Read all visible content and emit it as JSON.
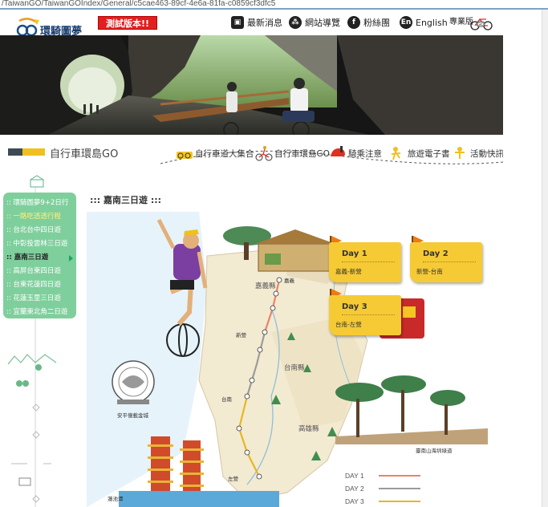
{
  "browser": {
    "url": "/TaiwanGO/TaiwanGOIndex/General/c5cae463-89cf-4e6a-81fa-c0859cf3dfc5"
  },
  "header": {
    "logo_text": "環騎圖夢",
    "test_badge": "測試版本!!",
    "nav": [
      {
        "label": "最新消息",
        "icon": "news-icon"
      },
      {
        "label": "網站導覽",
        "icon": "sitemap-icon"
      },
      {
        "label": "粉絲團",
        "icon": "facebook-icon"
      },
      {
        "label": "English",
        "icon": "english-icon"
      },
      {
        "label": "專業版",
        "icon": "bicycle-icon"
      }
    ]
  },
  "section": {
    "title": "自行車環島GO",
    "menu": [
      {
        "label": "自行車道大集合",
        "icon": "bike-road-icon"
      },
      {
        "label": "自行車環島GO",
        "icon": "cyclist-icon"
      },
      {
        "label": "騎乘注意",
        "icon": "helmet-icon"
      },
      {
        "label": "旅遊電子書",
        "icon": "ebook-icon"
      },
      {
        "label": "活動快訊",
        "icon": "event-icon"
      }
    ]
  },
  "sidebar": {
    "items": [
      {
        "label": ":: 環騎圖夢9+2日行"
      },
      {
        "label": ":: 一路吃透透行程"
      },
      {
        "label": ":: 台北台中四日遊"
      },
      {
        "label": ":: 中彰投雲林三日遊"
      },
      {
        "label": ":: 嘉南三日遊"
      },
      {
        "label": ":: 高屏台東四日遊"
      },
      {
        "label": ":: 台東花蓮四日遊"
      },
      {
        "label": ":: 花蓮玉里三日遊"
      },
      {
        "label": ":: 宜蘭東北角二日遊"
      }
    ]
  },
  "content": {
    "title": "::: 嘉南三日遊 :::",
    "days": [
      {
        "label": "Day 1",
        "route": "嘉義-新營"
      },
      {
        "label": "Day 2",
        "route": "新營-台南"
      },
      {
        "label": "Day 3",
        "route": "台南-左營"
      }
    ],
    "legend": [
      {
        "label": "DAY 1",
        "color": "#e8836b"
      },
      {
        "label": "DAY 2",
        "color": "#9b9b9b"
      },
      {
        "label": "DAY 3",
        "color": "#e5b820"
      }
    ],
    "map_labels": {
      "chiayi_county": "嘉義縣",
      "tainan_city": "台南縣",
      "kaohsiung_county": "高雄縣",
      "anping_fort": "安平億載金城",
      "lotus_pond": "蓮池潭",
      "tainan_mountain": "臺南山海圳綠道",
      "chiayi": "嘉義",
      "xinying": "新營",
      "tainan": "台南",
      "zuoying": "左營"
    },
    "colors": {
      "sidebar": "#7fcf9d",
      "daycard": "#f6ca35",
      "badge": "#e02020",
      "map_land": "#f3ead2",
      "map_sea": "#d7eef7"
    }
  }
}
